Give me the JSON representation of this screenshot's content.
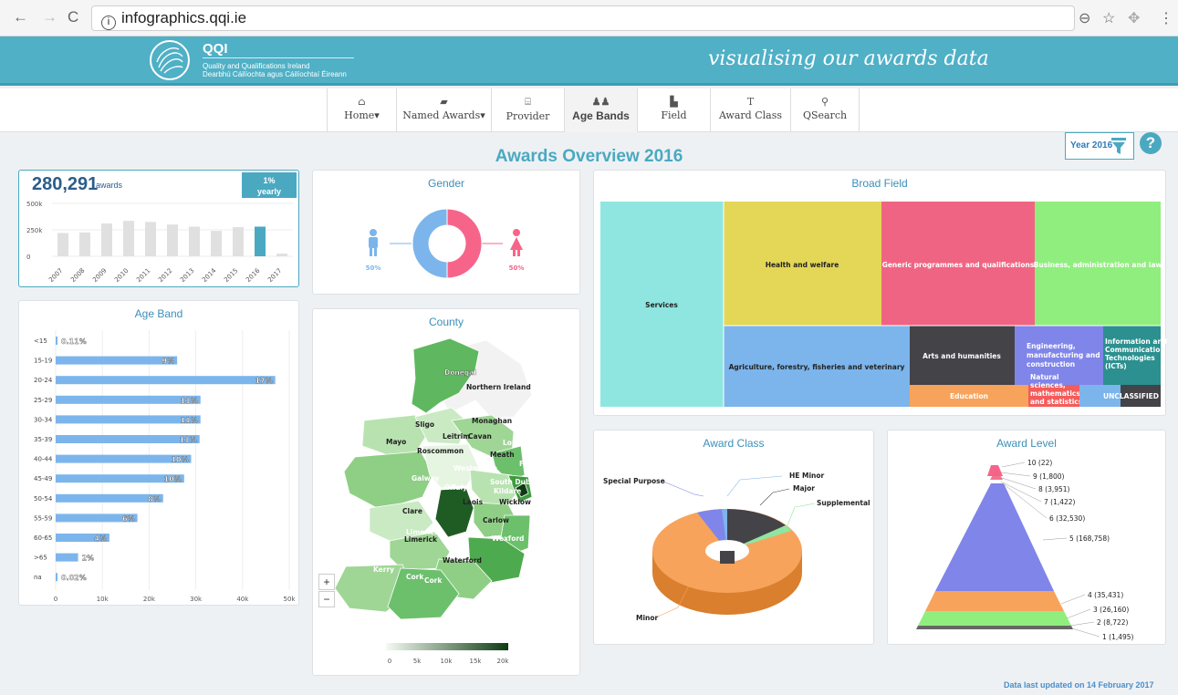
{
  "browser": {
    "url": "infographics.qqi.ie",
    "back": "←",
    "forward": "→",
    "reload": "C",
    "info": "i"
  },
  "header": {
    "brand": "QQI",
    "sub1": "Quality and Qualifications Ireland",
    "sub2": "Dearbhú Cáilíochta agus Cáilíochtaí Éireann",
    "tagline": "visualising our awards data"
  },
  "menu": [
    {
      "label": "Home▾",
      "icon": "home-icon"
    },
    {
      "label": "Named Awards▾",
      "icon": "book-icon"
    },
    {
      "label": "Provider",
      "icon": "bank-icon"
    },
    {
      "label": "Age Bands",
      "icon": "people-icon"
    },
    {
      "label": "Field",
      "icon": "factory-icon"
    },
    {
      "label": "Award Class",
      "icon": "text-icon"
    },
    {
      "label": "QSearch",
      "icon": "search-icon"
    }
  ],
  "page_title": "Awards Overview 2016",
  "year_filter": "Year 2016",
  "help": "?",
  "summary": {
    "total": "280,291",
    "unit": "awards",
    "change": "1%",
    "change_label": "yearly"
  },
  "panels": {
    "gender": "Gender",
    "broad_field": "Broad Field",
    "age_band": "Age Band",
    "county": "County",
    "award_class": "Award Class",
    "award_level": "Award Level"
  },
  "gender": {
    "male": "50%",
    "female": "50%",
    "colors": {
      "male": "#7cb5ec",
      "female": "#f7648a"
    }
  },
  "footer": "Data last updated on 14 February 2017",
  "chart_data": [
    {
      "type": "bar",
      "id": "awards-by-year",
      "categories": [
        "2007",
        "2008",
        "2009",
        "2010",
        "2011",
        "2012",
        "2013",
        "2014",
        "2015",
        "2016",
        "2017"
      ],
      "values": [
        220000,
        225000,
        310000,
        335000,
        325000,
        300000,
        280000,
        240000,
        275000,
        280291,
        25000
      ],
      "ytick_labels": [
        "0",
        "250k",
        "500k"
      ],
      "ylim": [
        0,
        500000
      ],
      "highlight": "2016"
    },
    {
      "type": "pie",
      "id": "gender",
      "title": "Gender",
      "categories": [
        "Male",
        "Female"
      ],
      "values": [
        50,
        50
      ],
      "labels": [
        "50%",
        "50%"
      ]
    },
    {
      "type": "heatmap",
      "id": "broad-field-treemap",
      "title": "Broad Field",
      "categories": [
        "Services",
        "Health and welfare",
        "Generic programmes and qualifications",
        "Business, administration and law",
        "Agriculture, forestry, fisheries and veterinary",
        "Arts and humanities",
        "Engineering, manufacturing and construction",
        "Information and Communication Technologies (ICTs)",
        "Education",
        "Natural sciences, mathematics and statistics",
        "UNCLASSIFIED"
      ],
      "colors": [
        "#8fe6e0",
        "#e4d757",
        "#f06483",
        "#90ee7e",
        "#7cb5ec",
        "#434348",
        "#8085e9",
        "#2b908f",
        "#f7a35c",
        "#f45b5b",
        "#434348"
      ]
    },
    {
      "type": "bar",
      "id": "age-band",
      "title": "Age Band",
      "categories": [
        "<15",
        "15-19",
        "20-24",
        "25-29",
        "30-34",
        "35-39",
        "40-44",
        "45-49",
        "50-54",
        "55-59",
        "60-65",
        ">65",
        "na"
      ],
      "values": [
        300,
        26000,
        47000,
        31000,
        31000,
        30800,
        29000,
        27500,
        23000,
        17500,
        11500,
        4800,
        60
      ],
      "labels": [
        "0.11%",
        "9%",
        "17%",
        "11%",
        "11%",
        "11%",
        "10%",
        "10%",
        "8%",
        "6%",
        "4%",
        "2%",
        "0.02%"
      ],
      "xtick_labels": [
        "0",
        "10k",
        "20k",
        "30k",
        "40k",
        "50k"
      ],
      "xlim": [
        0,
        50000
      ]
    },
    {
      "type": "heatmap",
      "id": "county-map",
      "title": "County",
      "labels": [
        "Donegal",
        "Northern Ireland",
        "Sligo",
        "Monaghan",
        "Mayo",
        "Leitrim",
        "Cavan",
        "Louth",
        "Roscommon",
        "Meath",
        "Fingal",
        "Westmeath",
        "Galway",
        "South Dublin",
        "Offaly",
        "Kildare",
        "Laois",
        "Wicklow",
        "Clare",
        "Carlow",
        "Limerick",
        "Wexford",
        "Limerick",
        "Waterford",
        "Kerry",
        "Cork",
        "Cork"
      ],
      "legend_ticks": [
        "0",
        "5k",
        "10k",
        "15k",
        "20k"
      ]
    },
    {
      "type": "pie",
      "id": "award-class",
      "title": "Award Class",
      "categories": [
        "Minor",
        "Special Purpose",
        "HE Minor",
        "Major",
        "Supplemental"
      ],
      "values": [
        76,
        6,
        1.5,
        14,
        2.5
      ]
    },
    {
      "type": "area",
      "id": "award-level",
      "title": "Award Level",
      "categories": [
        "10 (22)",
        "9 (1,800)",
        "8 (3,951)",
        "7 (1,422)",
        "6 (32,530)",
        "5 (168,758)",
        "4 (35,431)",
        "3 (26,160)",
        "2 (8,722)",
        "1 (1,495)"
      ],
      "values": [
        22,
        1800,
        3951,
        1422,
        32530,
        168758,
        35431,
        26160,
        8722,
        1495
      ]
    }
  ],
  "zoom": {
    "in": "+",
    "out": "−"
  }
}
